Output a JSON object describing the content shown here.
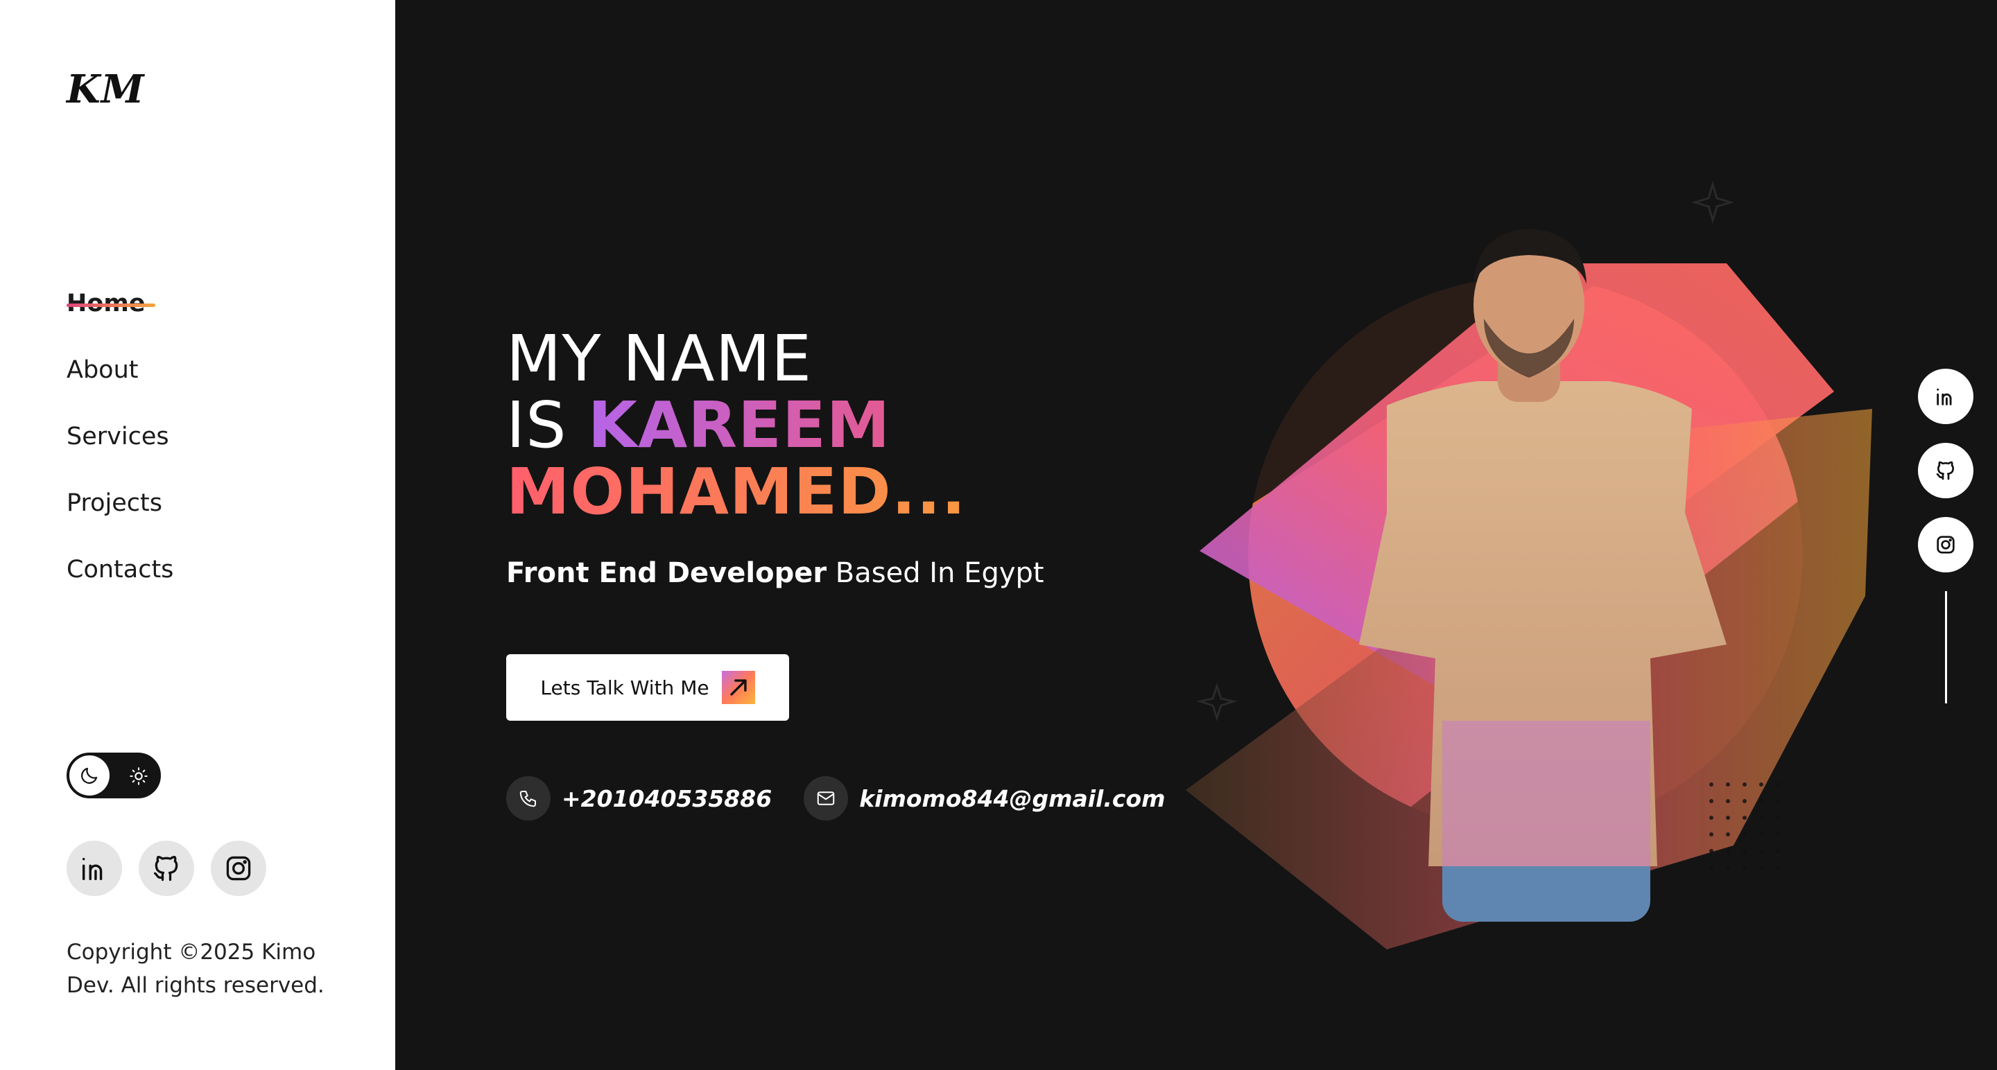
{
  "sidebar": {
    "logo": "KM",
    "nav": [
      "Home",
      "About",
      "Services",
      "Projects",
      "Contacts"
    ],
    "active_nav": "Home",
    "theme_toggle": {
      "mode": "dark",
      "icons": [
        "moon-icon",
        "sun-icon"
      ]
    },
    "socials": [
      "linkedin-icon",
      "github-icon",
      "instagram-icon"
    ],
    "copyright": "Copyright ©2025 Kimo Dev. All rights reserved."
  },
  "hero": {
    "line1": "MY NAME",
    "line2_prefix": "IS ",
    "line2_highlight": "KAREEM",
    "line3": "MOHAMED...",
    "subtitle_bold": "Front End Developer",
    "subtitle_rest": " Based In Egypt",
    "cta_label": "Lets Talk With Me",
    "phone": "+201040535886",
    "email": "kimomo844@gmail.com"
  },
  "right_socials": [
    "linkedin-icon",
    "github-icon",
    "instagram-icon"
  ],
  "colors": {
    "background": "#141414",
    "sidebar": "#ffffff",
    "gradient_purple": "#b565e8",
    "gradient_pink": "#ff5f6d",
    "gradient_orange": "#f7a23a"
  }
}
